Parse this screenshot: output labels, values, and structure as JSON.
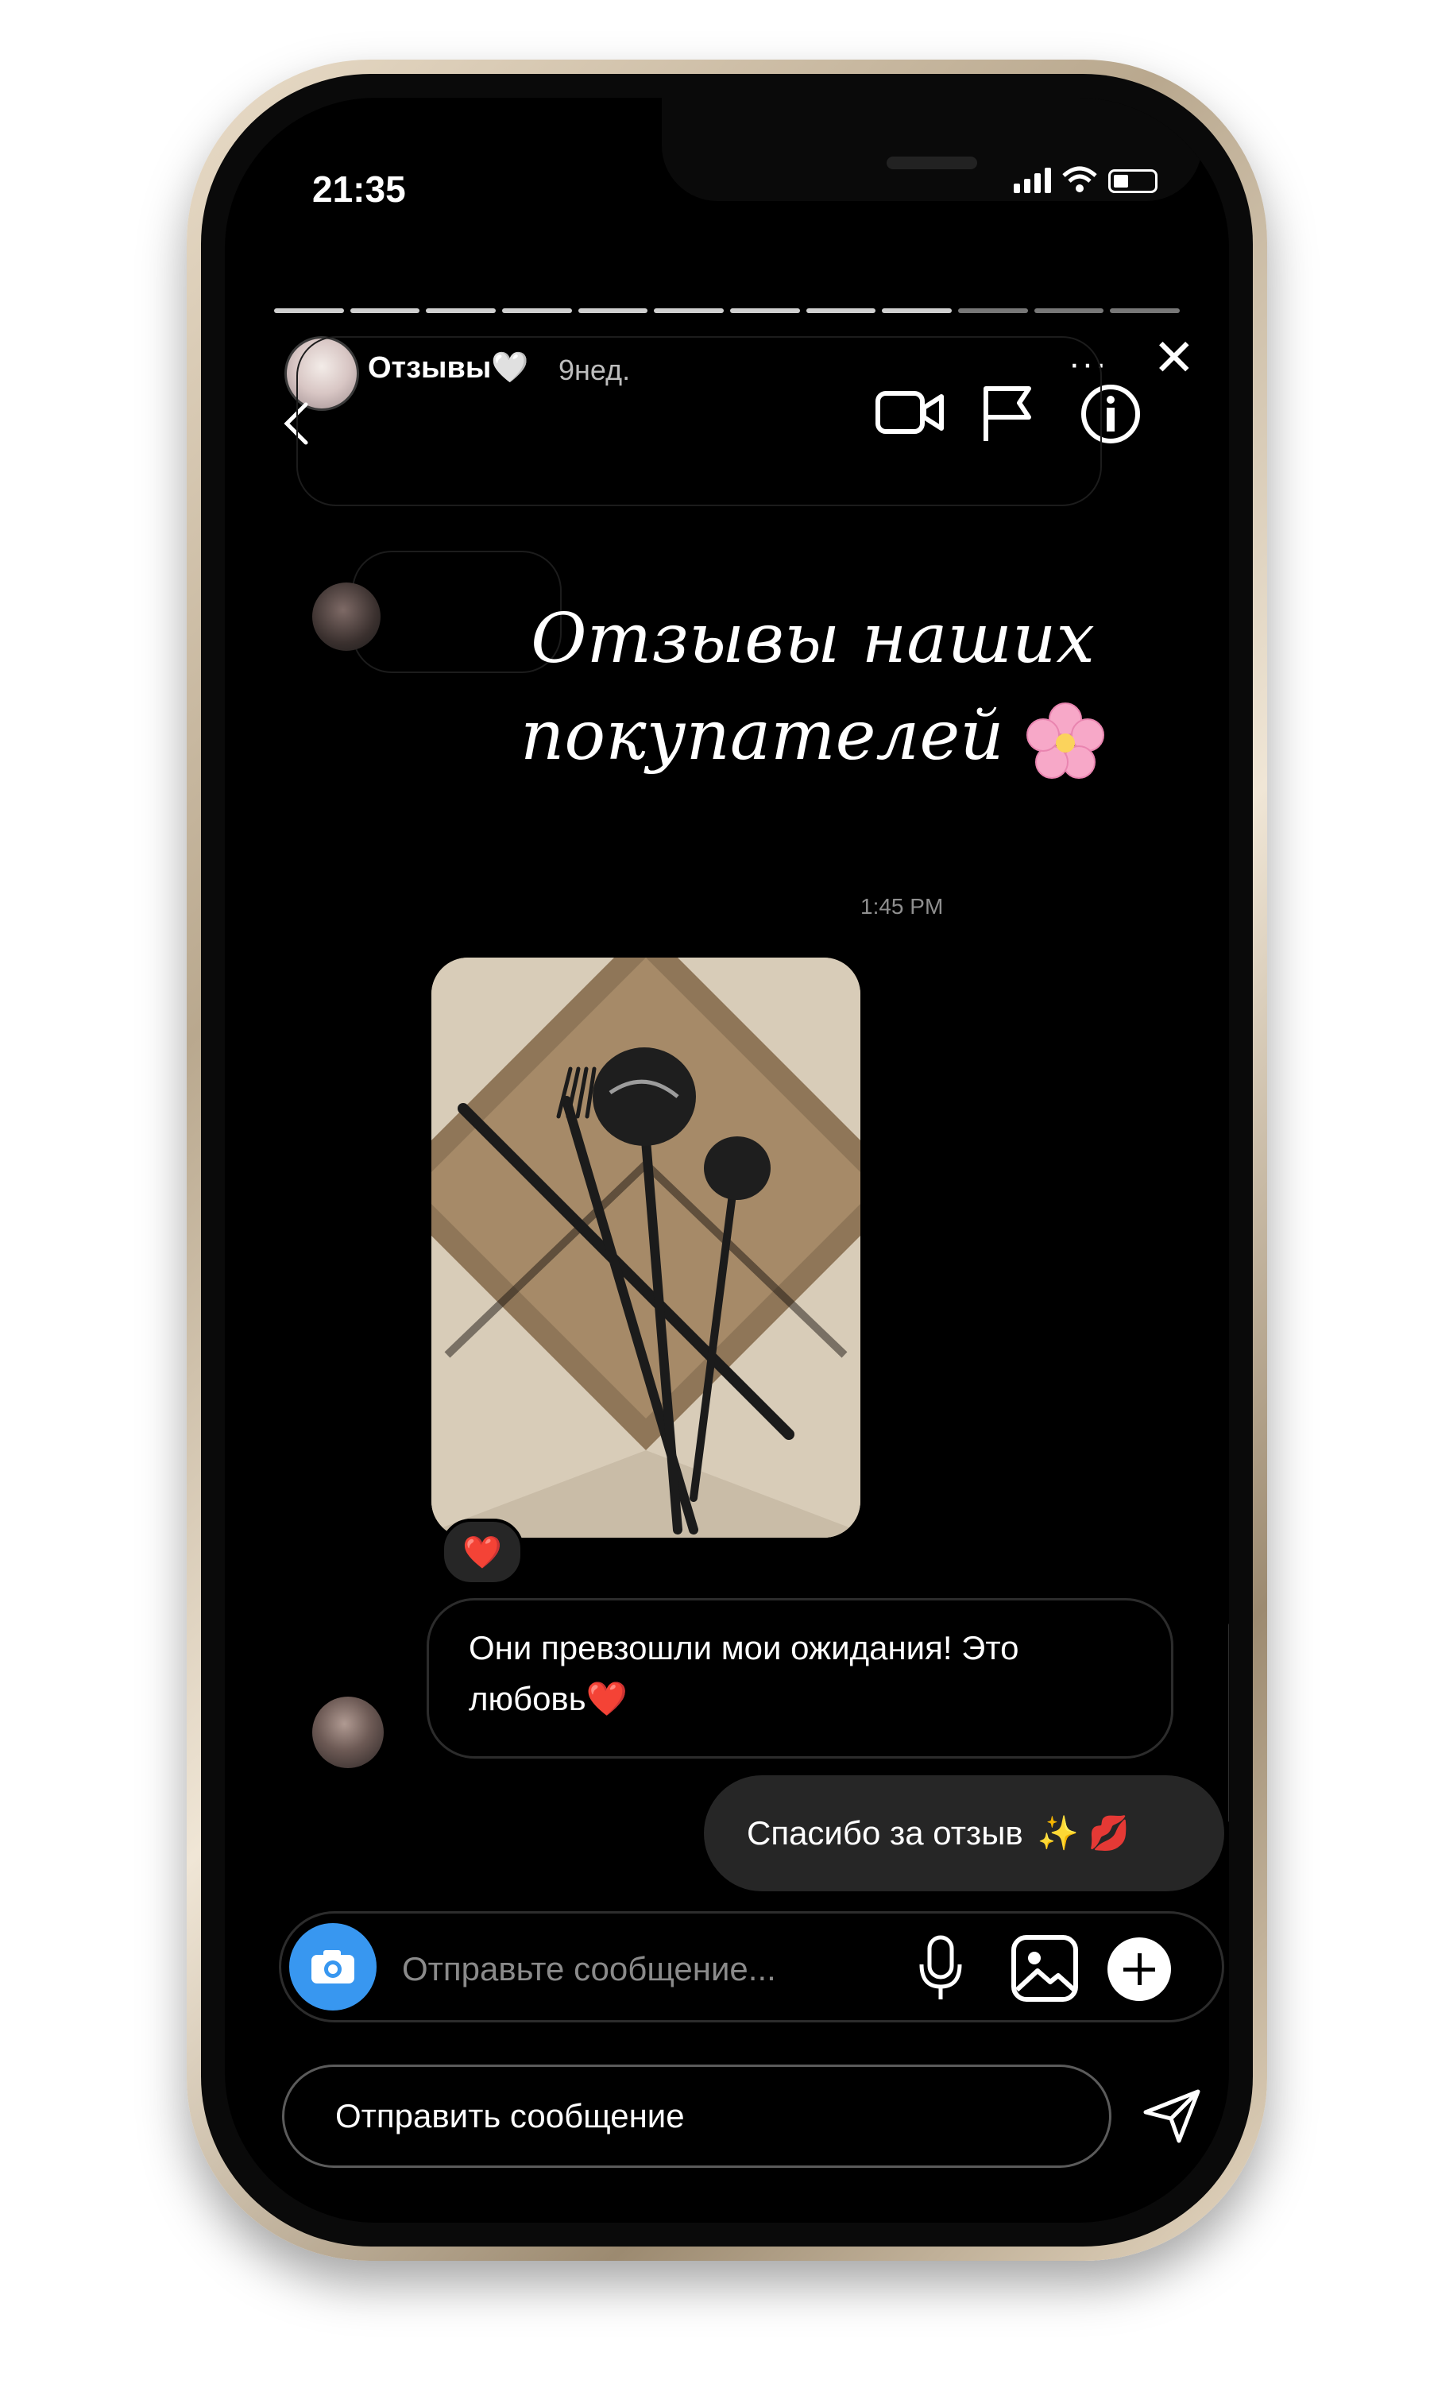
{
  "status_bar": {
    "time": "21:35"
  },
  "story": {
    "title": "Отзывы",
    "heart": "🤍",
    "age": "9нед.",
    "more": "···",
    "close": "✕"
  },
  "overlay": {
    "line1": "Отзывы наших",
    "line2": "покупателей"
  },
  "chat": {
    "timestamp": "1:45 PM",
    "photo_reaction": "❤️",
    "incoming_text": "Они превзошли мои ожидания! Это любовь❤️",
    "outgoing_text": "Спасибо за отзыв",
    "outgoing_emoji": "✨ 💋"
  },
  "composer": {
    "placeholder": "Отправьте сообщение..."
  },
  "reply": {
    "placeholder": "Отправить сообщение"
  },
  "icons": [
    "back-arrow-icon",
    "video-camera-icon",
    "flag-icon",
    "info-icon",
    "camera-icon",
    "microphone-icon",
    "gallery-icon",
    "plus-icon",
    "send-icon"
  ],
  "colors": {
    "background": "#000000",
    "accent": "#3897f0",
    "bubble": "#262626"
  }
}
